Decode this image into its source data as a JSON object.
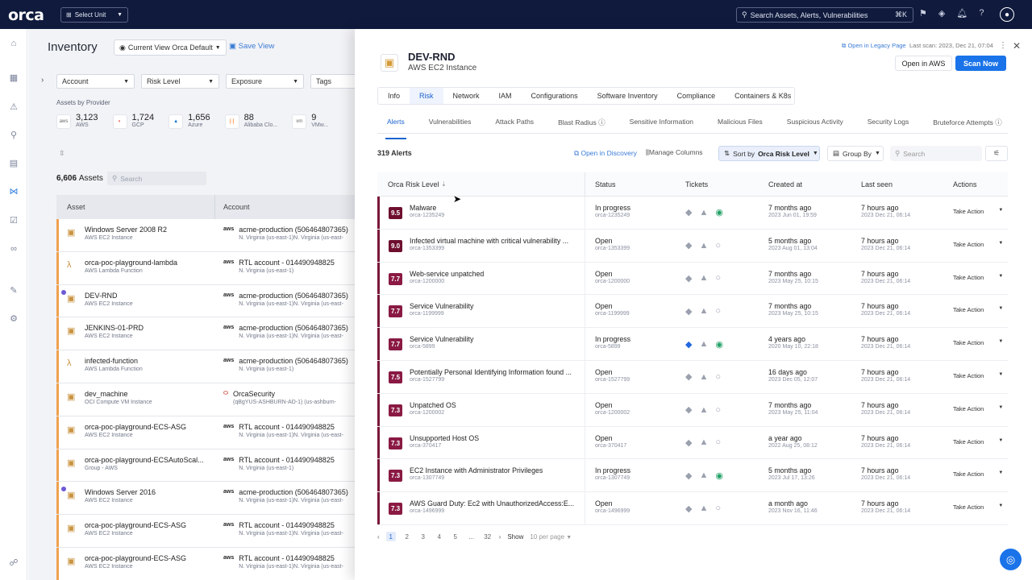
{
  "topbar": {
    "logo": "orca",
    "unit_select": "Select Unit",
    "search_placeholder": "Search Assets, Alerts, Vulnerabilities",
    "search_shortcut": "⌘K"
  },
  "inventory": {
    "title": "Inventory",
    "current_view": "Current View Orca Default",
    "save_view": "Save View",
    "filters": [
      "Account",
      "Risk Level",
      "Exposure",
      "Tags"
    ],
    "assets_by_provider_label": "Assets by Provider",
    "providers": [
      {
        "icon": "aws",
        "count": "3,123",
        "label": "AWS"
      },
      {
        "icon": "gcp",
        "count": "1,724",
        "label": "GCP"
      },
      {
        "icon": "azure",
        "count": "1,656",
        "label": "Azure"
      },
      {
        "icon": "alibaba",
        "count": "88",
        "label": "Alibaba Clo..."
      },
      {
        "icon": "vmware",
        "count": "9",
        "label": "VMw..."
      }
    ],
    "asset_count": "6,606",
    "asset_count_label": "Assets",
    "search_placeholder": "Search",
    "columns": [
      "Asset",
      "Account"
    ],
    "rows": [
      {
        "name": "Windows Server 2008 R2",
        "type": "AWS EC2 Instance",
        "account": "acme-production (506464807365)",
        "region": "N. Virginia (us-east-1)N. Virginia (us-east-",
        "provider": "aws"
      },
      {
        "name": "orca-poc-playground-lambda",
        "type": "AWS Lambda Function",
        "account": "RTL account - 014490948825",
        "region": "N. Virginia (us-east-1)",
        "provider": "aws"
      },
      {
        "name": "DEV-RND",
        "type": "AWS EC2 Instance",
        "account": "acme-production (506464807365)",
        "region": "N. Virginia (us-east-1)N. Virginia (us-east-",
        "provider": "aws"
      },
      {
        "name": "JENKINS-01-PRD",
        "type": "AWS EC2 Instance",
        "account": "acme-production (506464807365)",
        "region": "N. Virginia (us-east-1)N. Virginia (us-east-",
        "provider": "aws"
      },
      {
        "name": "infected-function",
        "type": "AWS Lambda Function",
        "account": "acme-production (506464807365)",
        "region": "N. Virginia (us-east-1)",
        "provider": "aws"
      },
      {
        "name": "dev_machine",
        "type": "OCI Compute VM Instance",
        "account": "OrcaSecurity",
        "region": "(qBgYUS-ASHBURN-AD-1) (us-ashburn-",
        "provider": "oci"
      },
      {
        "name": "orca-poc-playground-ECS-ASG",
        "type": "AWS EC2 Instance",
        "account": "RTL account - 014490948825",
        "region": "N. Virginia (us-east-1)N. Virginia (us-east-",
        "provider": "aws"
      },
      {
        "name": "orca-poc-playground-ECSAutoScal...",
        "type": "Group - AWS",
        "account": "RTL account - 014490948825",
        "region": "N. Virginia (us-east-1)",
        "provider": "aws"
      },
      {
        "name": "Windows Server 2016",
        "type": "AWS EC2 Instance",
        "account": "acme-production (506464807365)",
        "region": "N. Virginia (us-east-1)N. Virginia (us-east-",
        "provider": "aws"
      },
      {
        "name": "orca-poc-playground-ECS-ASG",
        "type": "AWS EC2 Instance",
        "account": "RTL account - 014490948825",
        "region": "N. Virginia (us-east-1)N. Virginia (us-east-",
        "provider": "aws"
      },
      {
        "name": "orca-poc-playground-ECS-ASG",
        "type": "AWS EC2 Instance",
        "account": "RTL account - 014490948825",
        "region": "N. Virginia (us-east-1)N. Virginia (us-east-",
        "provider": "aws"
      }
    ]
  },
  "panel": {
    "title": "DEV-RND",
    "subtitle": "AWS EC2 Instance",
    "legacy_link": "Open in Legacy Page",
    "last_scan": "Last scan: 2023, Dec 21, 07:04",
    "open_in_aws": "Open in AWS",
    "scan_now": "Scan Now",
    "tabs": [
      "Info",
      "Risk",
      "Network",
      "IAM",
      "Configurations",
      "Software Inventory",
      "Compliance",
      "Containers & K8s"
    ],
    "subtabs": [
      "Alerts",
      "Vulnerabilities",
      "Attack Paths",
      "Blast Radius ⓘ",
      "Sensitive Information",
      "Malicious Files",
      "Suspicious Activity",
      "Security Logs",
      "Bruteforce Attempts ⓘ"
    ],
    "alert_count": "319 Alerts",
    "open_in_discovery": "Open in Discovery",
    "manage_columns": "Manage Columns",
    "sort_by_label": "Sort by",
    "sort_by_value": "Orca Risk Level",
    "group_by": "Group By",
    "search_placeholder": "Search",
    "columns": [
      "Orca Risk Level",
      "Status",
      "Tickets",
      "Created at",
      "Last seen",
      "Actions"
    ],
    "alerts": [
      {
        "score": "9.5",
        "title": "Malware",
        "id": "orca-1235249",
        "status": "In progress",
        "status_id": "orca-1235249",
        "jira_linked": false,
        "ticket_done": true,
        "created_rel": "7 months ago",
        "created": "2023 Jun 01, 19:59",
        "seen_rel": "7 hours ago",
        "seen": "2023 Dec 21, 06:14",
        "action": "Take Action"
      },
      {
        "score": "9.0",
        "title": "Infected virtual machine with critical vulnerability ...",
        "id": "orca-1353399",
        "status": "Open",
        "status_id": "orca-1353399",
        "jira_linked": false,
        "ticket_done": false,
        "created_rel": "5 months ago",
        "created": "2023 Aug 01, 13:04",
        "seen_rel": "7 hours ago",
        "seen": "2023 Dec 21, 06:14",
        "action": "Take Action"
      },
      {
        "score": "7.7",
        "title": "Web-service unpatched",
        "id": "orca-1200000",
        "status": "Open",
        "status_id": "orca-1200000",
        "jira_linked": false,
        "ticket_done": false,
        "created_rel": "7 months ago",
        "created": "2023 May 25, 10:15",
        "seen_rel": "7 hours ago",
        "seen": "2023 Dec 21, 06:14",
        "action": "Take Action"
      },
      {
        "score": "7.7",
        "title": "Service Vulnerability",
        "id": "orca-1199999",
        "status": "Open",
        "status_id": "orca-1199999",
        "jira_linked": false,
        "ticket_done": false,
        "created_rel": "7 months ago",
        "created": "2023 May 25, 10:15",
        "seen_rel": "7 hours ago",
        "seen": "2023 Dec 21, 06:14",
        "action": "Take Action"
      },
      {
        "score": "7.7",
        "title": "Service Vulnerability",
        "id": "orca-5899",
        "status": "In progress",
        "status_id": "orca-5899",
        "jira_linked": true,
        "ticket_done": true,
        "created_rel": "4 years ago",
        "created": "2020 May 10, 22:18",
        "seen_rel": "7 hours ago",
        "seen": "2023 Dec 21, 06:14",
        "action": "Take Action"
      },
      {
        "score": "7.5",
        "title": "Potentially Personal Identifying Information found ...",
        "id": "orca-1527799",
        "status": "Open",
        "status_id": "orca-1527799",
        "jira_linked": false,
        "ticket_done": false,
        "created_rel": "16 days ago",
        "created": "2023 Dec 05, 12:07",
        "seen_rel": "7 hours ago",
        "seen": "2023 Dec 21, 06:14",
        "action": "Take Action"
      },
      {
        "score": "7.3",
        "title": "Unpatched OS",
        "id": "orca-1200002",
        "status": "Open",
        "status_id": "orca-1200002",
        "jira_linked": false,
        "ticket_done": false,
        "created_rel": "7 months ago",
        "created": "2023 May 25, 11:04",
        "seen_rel": "7 hours ago",
        "seen": "2023 Dec 21, 06:14",
        "action": "Take Action"
      },
      {
        "score": "7.3",
        "title": "Unsupported Host OS",
        "id": "orca-370417",
        "status": "Open",
        "status_id": "orca-370417",
        "jira_linked": false,
        "ticket_done": false,
        "created_rel": "a year ago",
        "created": "2022 Aug 25, 08:12",
        "seen_rel": "7 hours ago",
        "seen": "2023 Dec 21, 06:14",
        "action": "Take Action"
      },
      {
        "score": "7.3",
        "title": "EC2 Instance with Administrator Privileges",
        "id": "orca-1307749",
        "status": "In progress",
        "status_id": "orca-1307749",
        "jira_linked": false,
        "ticket_done": true,
        "created_rel": "5 months ago",
        "created": "2023 Jul 17, 13:26",
        "seen_rel": "7 hours ago",
        "seen": "2023 Dec 21, 06:14",
        "action": "Take Action"
      },
      {
        "score": "7.3",
        "title": "AWS Guard Duty: Ec2 with UnauthorizedAccess:E...",
        "id": "orca-1496999",
        "status": "Open",
        "status_id": "orca-1496999",
        "jira_linked": false,
        "ticket_done": false,
        "created_rel": "a month ago",
        "created": "2023 Nov 16, 11:46",
        "seen_rel": "7 hours ago",
        "seen": "2023 Dec 21, 06:14",
        "action": "Take Action"
      }
    ],
    "pagination": {
      "pages": [
        "1",
        "2",
        "3",
        "4",
        "5",
        "...",
        "32"
      ],
      "show_label": "Show",
      "per_page": "10 per page"
    }
  }
}
